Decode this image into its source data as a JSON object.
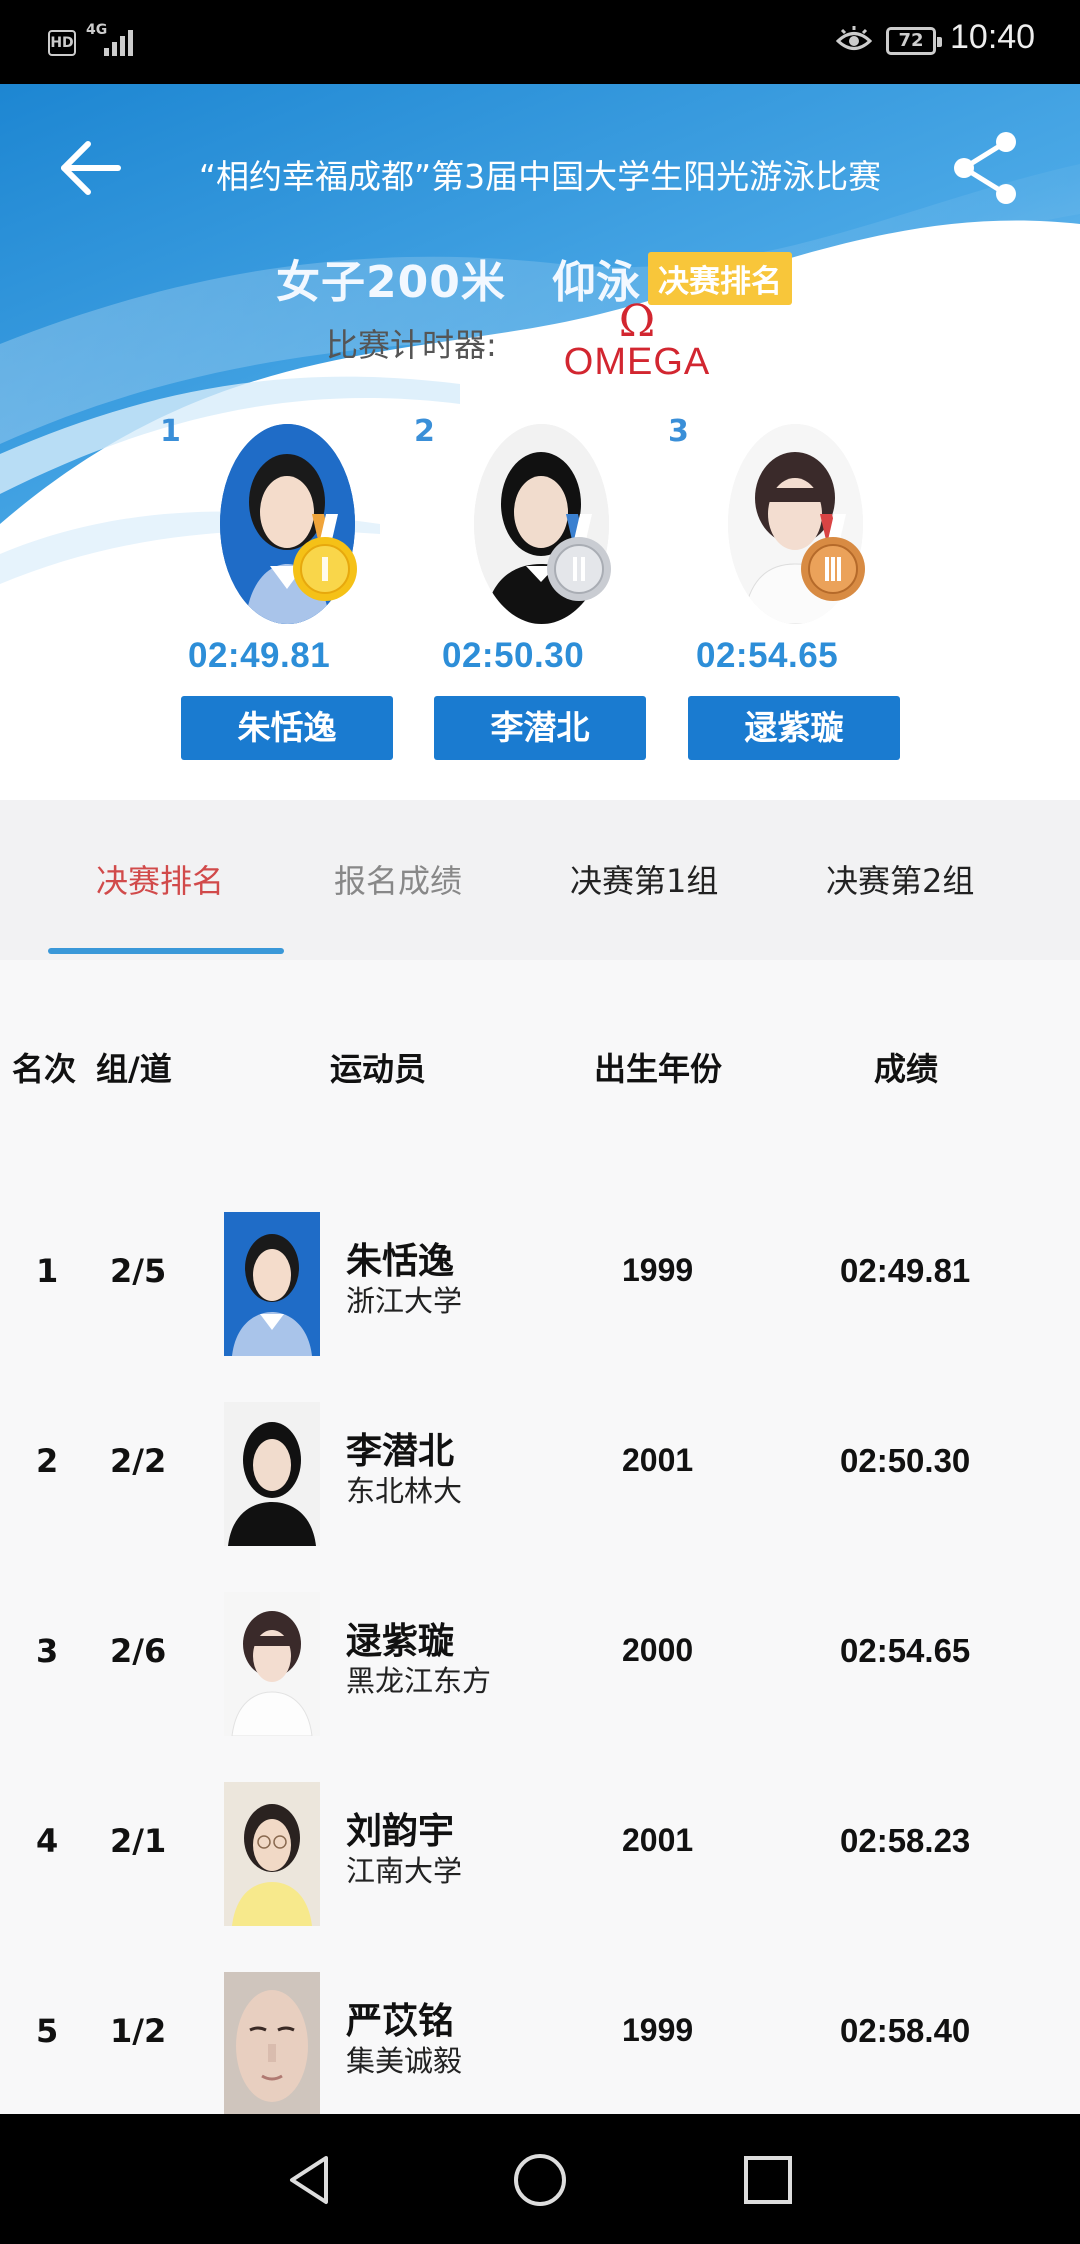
{
  "status_bar": {
    "hd_label": "HD",
    "network": "4G",
    "battery": "72",
    "time": "10:40"
  },
  "header": {
    "title": "“相约幸福成都”第3届中国大学生阳光游泳比赛",
    "event_name": "女子200米",
    "stroke": "仰泳",
    "rank_badge": "决赛排名",
    "timer_label": "比赛计时器:",
    "timer_brand_symbol": "Ω",
    "timer_brand": "OMEGA"
  },
  "podium": [
    {
      "place": "1",
      "time": "02:49.81",
      "name": "朱恬逸",
      "medal": "gold"
    },
    {
      "place": "2",
      "time": "02:50.30",
      "name": "李潜北",
      "medal": "silver"
    },
    {
      "place": "3",
      "time": "02:54.65",
      "name": "逯紫璇",
      "medal": "bronze"
    }
  ],
  "tabs": [
    {
      "label": "决赛排名",
      "active": true
    },
    {
      "label": "报名成绩",
      "active": false
    },
    {
      "label": "决赛第1组",
      "active": false
    },
    {
      "label": "决赛第2组",
      "active": false
    }
  ],
  "table": {
    "headers": {
      "rank": "名次",
      "lane": "组/道",
      "athlete": "运动员",
      "birth_year": "出生年份",
      "result": "成绩"
    },
    "rows": [
      {
        "rank": "1",
        "lane": "2/5",
        "name": "朱恬逸",
        "school": "浙江大学",
        "year": "1999",
        "result": "02:49.81"
      },
      {
        "rank": "2",
        "lane": "2/2",
        "name": "李潜北",
        "school": "东北林大",
        "year": "2001",
        "result": "02:50.30"
      },
      {
        "rank": "3",
        "lane": "2/6",
        "name": "逯紫璇",
        "school": "黑龙江东方",
        "year": "2000",
        "result": "02:54.65"
      },
      {
        "rank": "4",
        "lane": "2/1",
        "name": "刘韵宇",
        "school": "江南大学",
        "year": "2001",
        "result": "02:58.23"
      },
      {
        "rank": "5",
        "lane": "1/2",
        "name": "严苡铭",
        "school": "集美诚毅",
        "year": "1999",
        "result": "02:58.40"
      }
    ]
  },
  "colors": {
    "accent_blue": "#1a7bd0",
    "tab_active": "#d14a4a",
    "badge_yellow": "#f8c63a",
    "omega_red": "#d22630"
  }
}
